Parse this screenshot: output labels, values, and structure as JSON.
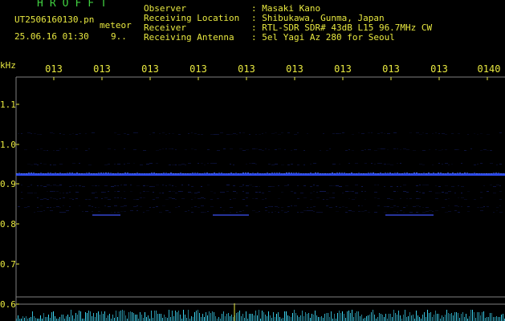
{
  "header": {
    "logo": "HROFFT",
    "file_name": "UT2506160130.pn",
    "meteor_label": "meteor",
    "date_time": "25.06.16 01:30",
    "count": "9.."
  },
  "station": [
    {
      "label": "Observer",
      "value": ": Masaki Kano"
    },
    {
      "label": "Receiving Location",
      "value": ": Shibukawa, Gunma, Japan"
    },
    {
      "label": "Receiver",
      "value": ": RTL-SDR SDR# 43dB L15 96.7MHz CW"
    },
    {
      "label": "Receiving Antenna",
      "value": ": 5el Yagi Az 280 for Seoul"
    }
  ],
  "time_axis": {
    "ticks": [
      "013",
      "013",
      "013",
      "013",
      "013",
      "013",
      "013",
      "013",
      "013",
      "0140"
    ]
  },
  "freq_axis": {
    "unit": "kHz",
    "ticks": [
      "1.1",
      "1.0",
      "0.9",
      "0.8",
      "0.7",
      "0.6"
    ]
  },
  "colors": {
    "text_yellow": "#e8e840",
    "text_green": "#40d040",
    "trace_blue": "#3050ff",
    "noise_cyan": "#40e0ff",
    "grid": "#808080"
  }
}
